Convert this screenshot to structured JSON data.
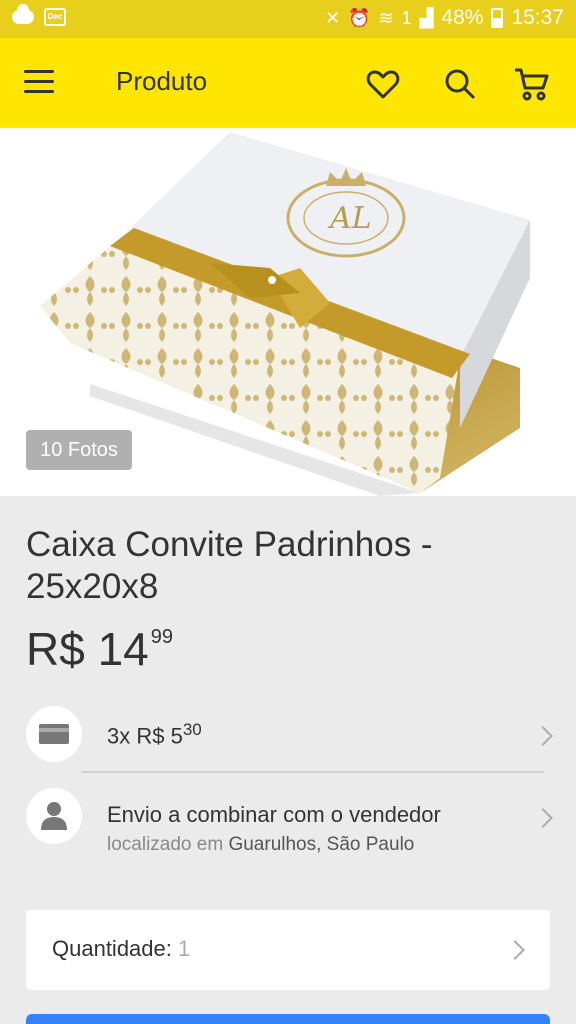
{
  "status_bar": {
    "battery": "48%",
    "time": "15:37",
    "sim": "1"
  },
  "app_bar": {
    "title": "Produto"
  },
  "product": {
    "photo_count_label": "10 Fotos",
    "title": "Caixa Convite Padrinhos - 25x20x8",
    "price_currency": "R$",
    "price_integer": "14",
    "price_cents": "99"
  },
  "installments": {
    "label": "3x R$ 5",
    "cents": "30"
  },
  "shipping": {
    "title": "Envio a combinar com o vendedor",
    "location_prefix": "localizado em",
    "location": "Guarulhos, São Paulo"
  },
  "quantity": {
    "label": "Quantidade:",
    "value": "1"
  },
  "colors": {
    "brand_yellow": "#ffe600",
    "status_yellow": "#e8cf1c",
    "buy_blue": "#3483fa"
  }
}
